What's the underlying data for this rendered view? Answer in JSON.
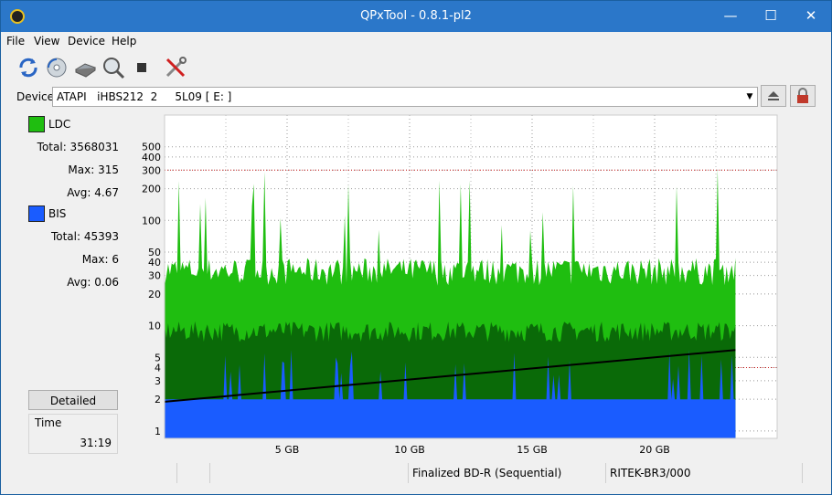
{
  "window": {
    "title": "QPxTool - 0.8.1-pl2"
  },
  "menu": [
    "File",
    "View",
    "Device",
    "Help"
  ],
  "toolbar": {
    "icons": [
      "refresh-icon",
      "disc-info-icon",
      "drive-info-icon",
      "scan-icon",
      "stop-icon",
      "settings-tools-icon"
    ]
  },
  "device": {
    "label": "Device:",
    "value": "ATAPI   iHBS212  2     5L09 [ E: ]"
  },
  "legend": {
    "ldc": {
      "name": "LDC",
      "color": "#1fbe10",
      "total": "Total: 3568031",
      "max": "Max: 315",
      "avg": "Avg: 4.67"
    },
    "bis": {
      "name": "BIS",
      "color": "#1a5cff",
      "total": "Total: 45393",
      "max": "Max: 6",
      "avg": "Avg: 0.06"
    }
  },
  "detailed_label": "Detailed",
  "time": {
    "label": "Time",
    "value": "31:19"
  },
  "status": {
    "cells": [
      "",
      "",
      "",
      "Finalized BD-R (Sequential)",
      "RITEK-BR3/000",
      ""
    ]
  },
  "chart_data": {
    "type": "area",
    "x_label_unit": "GB",
    "x_ticks": [
      "5 GB",
      "10 GB",
      "15 GB",
      "20 GB"
    ],
    "x_tick_values": [
      5,
      10,
      15,
      20
    ],
    "xlim": [
      0,
      25
    ],
    "data_end_gb": 23.3,
    "y_left": {
      "scale": "log",
      "ticks": [
        "1",
        "2",
        "3",
        "4",
        "5",
        "10",
        "20",
        "30",
        "40",
        "50",
        "100",
        "200",
        "300",
        "400",
        "500"
      ],
      "tick_values": [
        1,
        2,
        3,
        4,
        5,
        10,
        20,
        30,
        40,
        50,
        100,
        200,
        300,
        400,
        500
      ],
      "lim": [
        0.85,
        1000
      ]
    },
    "y_right": {
      "scale": "linear",
      "ticks": [
        "2",
        "4",
        "6",
        "8",
        "10",
        "12",
        "14"
      ],
      "tick_values": [
        2,
        4,
        6,
        8,
        10,
        12,
        14
      ],
      "lim": [
        0,
        15
      ]
    },
    "red_reference_lines_left_axis": [
      300,
      4
    ],
    "series": [
      {
        "name": "LDC",
        "color": "#1fbe10",
        "typical_peak": 40,
        "max": 315,
        "avg": 4.67
      },
      {
        "name": "BIS",
        "color": "#1a5cff",
        "typical": 2,
        "max": 6,
        "avg": 0.06
      }
    ],
    "speed_curve": {
      "color": "#000000",
      "x": [
        0,
        23.3
      ],
      "y": [
        1.7,
        4.1
      ],
      "axis": "right"
    },
    "grid": true
  }
}
